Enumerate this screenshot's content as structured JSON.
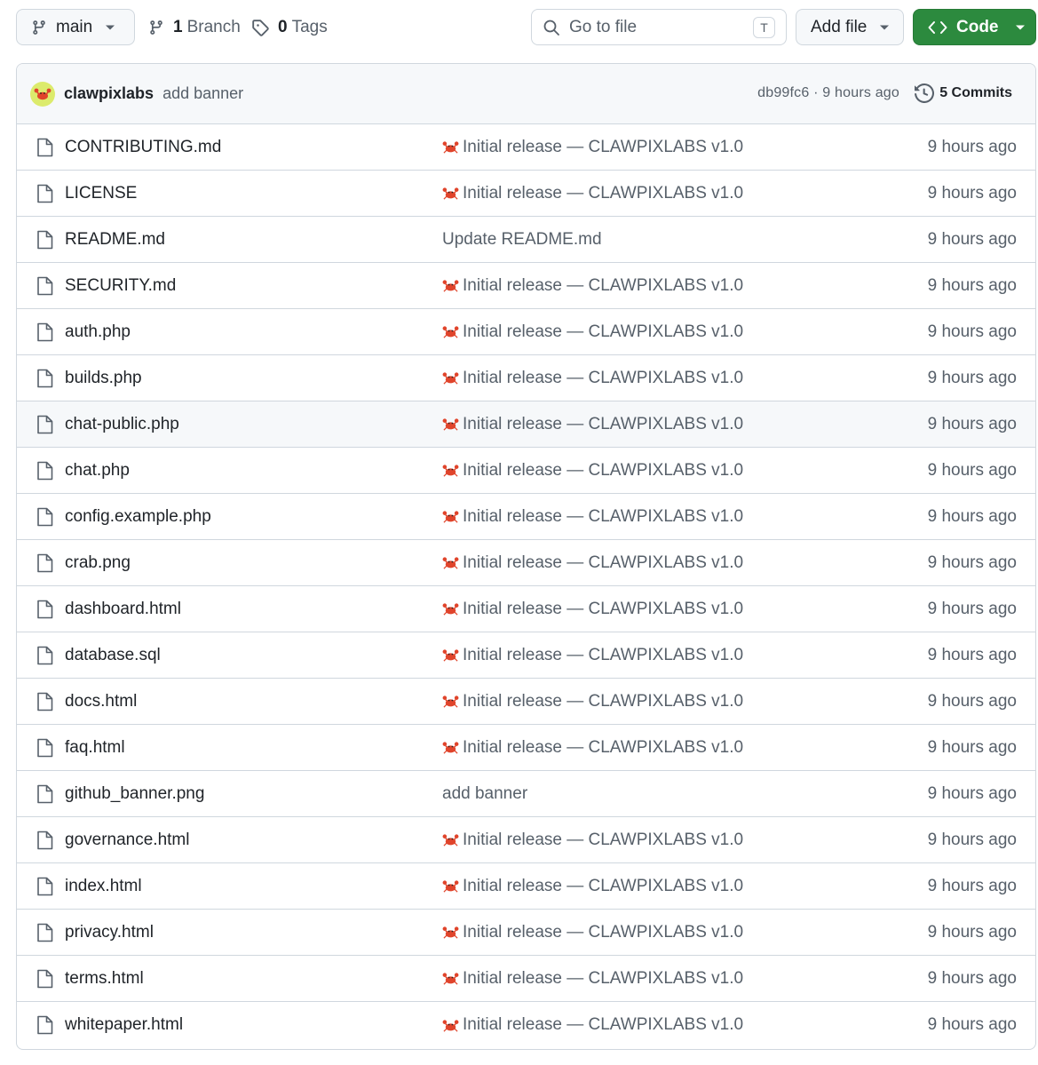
{
  "toolbar": {
    "branch": "main",
    "branches_count": "1",
    "branches_label": "Branch",
    "tags_count": "0",
    "tags_label": "Tags",
    "search_placeholder": "Go to file",
    "search_shortcut": "T",
    "add_file_label": "Add file",
    "code_label": "Code"
  },
  "latest_commit": {
    "author": "clawpixlabs",
    "message": "add banner",
    "sha_time": "db99fc6 · 9 hours ago",
    "commits_label": "5 Commits"
  },
  "colors": {
    "code_button": "#2c8a3e",
    "avatar_bg": "#dceb6c",
    "crab": "#e0442b",
    "border": "#d0d7de"
  },
  "files": [
    {
      "name": "CONTRIBUTING.md",
      "message": "Initial release — CLAWPIXLABS v1.0",
      "crab": true,
      "age": "9 hours ago"
    },
    {
      "name": "LICENSE",
      "message": "Initial release — CLAWPIXLABS v1.0",
      "crab": true,
      "age": "9 hours ago"
    },
    {
      "name": "README.md",
      "message": "Update README.md",
      "crab": false,
      "age": "9 hours ago"
    },
    {
      "name": "SECURITY.md",
      "message": "Initial release — CLAWPIXLABS v1.0",
      "crab": true,
      "age": "9 hours ago"
    },
    {
      "name": "auth.php",
      "message": "Initial release — CLAWPIXLABS v1.0",
      "crab": true,
      "age": "9 hours ago"
    },
    {
      "name": "builds.php",
      "message": "Initial release — CLAWPIXLABS v1.0",
      "crab": true,
      "age": "9 hours ago"
    },
    {
      "name": "chat-public.php",
      "message": "Initial release — CLAWPIXLABS v1.0",
      "crab": true,
      "age": "9 hours ago",
      "highlighted": true
    },
    {
      "name": "chat.php",
      "message": "Initial release — CLAWPIXLABS v1.0",
      "crab": true,
      "age": "9 hours ago"
    },
    {
      "name": "config.example.php",
      "message": "Initial release — CLAWPIXLABS v1.0",
      "crab": true,
      "age": "9 hours ago"
    },
    {
      "name": "crab.png",
      "message": "Initial release — CLAWPIXLABS v1.0",
      "crab": true,
      "age": "9 hours ago"
    },
    {
      "name": "dashboard.html",
      "message": "Initial release — CLAWPIXLABS v1.0",
      "crab": true,
      "age": "9 hours ago"
    },
    {
      "name": "database.sql",
      "message": "Initial release — CLAWPIXLABS v1.0",
      "crab": true,
      "age": "9 hours ago"
    },
    {
      "name": "docs.html",
      "message": "Initial release — CLAWPIXLABS v1.0",
      "crab": true,
      "age": "9 hours ago"
    },
    {
      "name": "faq.html",
      "message": "Initial release — CLAWPIXLABS v1.0",
      "crab": true,
      "age": "9 hours ago"
    },
    {
      "name": "github_banner.png",
      "message": "add banner",
      "crab": false,
      "age": "9 hours ago"
    },
    {
      "name": "governance.html",
      "message": "Initial release — CLAWPIXLABS v1.0",
      "crab": true,
      "age": "9 hours ago"
    },
    {
      "name": "index.html",
      "message": "Initial release — CLAWPIXLABS v1.0",
      "crab": true,
      "age": "9 hours ago"
    },
    {
      "name": "privacy.html",
      "message": "Initial release — CLAWPIXLABS v1.0",
      "crab": true,
      "age": "9 hours ago"
    },
    {
      "name": "terms.html",
      "message": "Initial release — CLAWPIXLABS v1.0",
      "crab": true,
      "age": "9 hours ago"
    },
    {
      "name": "whitepaper.html",
      "message": "Initial release — CLAWPIXLABS v1.0",
      "crab": true,
      "age": "9 hours ago"
    }
  ]
}
